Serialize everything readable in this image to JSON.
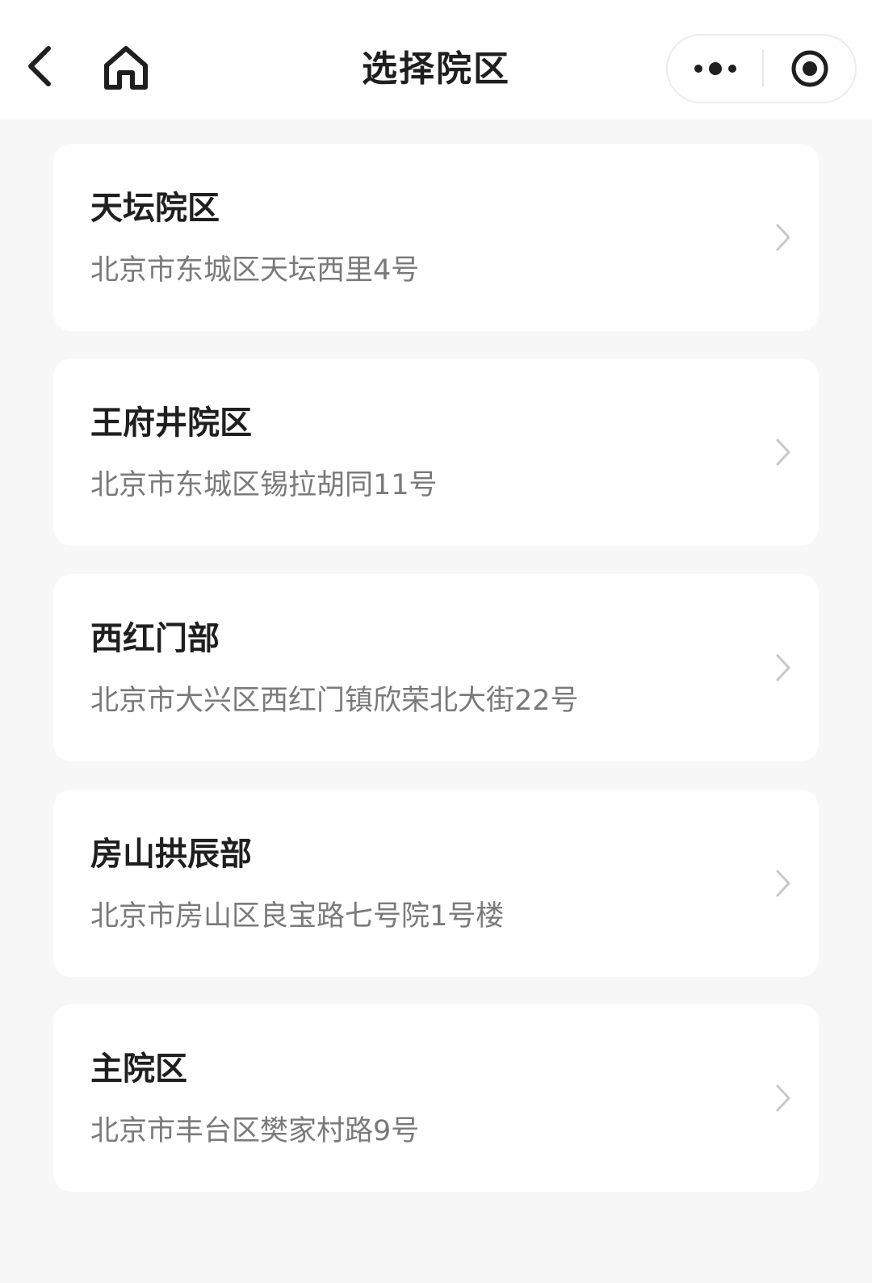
{
  "header": {
    "title": "选择院区",
    "icons": {
      "back": "chevron-left-icon",
      "home": "home-icon",
      "more": "more-dots-icon",
      "close": "close-target-icon"
    }
  },
  "campuses": [
    {
      "name": "天坛院区",
      "address": "北京市东城区天坛西里4号"
    },
    {
      "name": "王府井院区",
      "address": "北京市东城区锡拉胡同11号"
    },
    {
      "name": "西红门部",
      "address": "北京市大兴区西红门镇欣荣北大街22号"
    },
    {
      "name": "房山拱辰部",
      "address": "北京市房山区良宝路七号院1号楼"
    },
    {
      "name": "主院区",
      "address": "北京市丰台区樊家村路9号"
    }
  ],
  "colors": {
    "background": "#f7f7f7",
    "card": "#ffffff",
    "title_text": "#1f1f1f",
    "address_text": "#7a7a7a",
    "chevron": "#c8c8c8"
  }
}
